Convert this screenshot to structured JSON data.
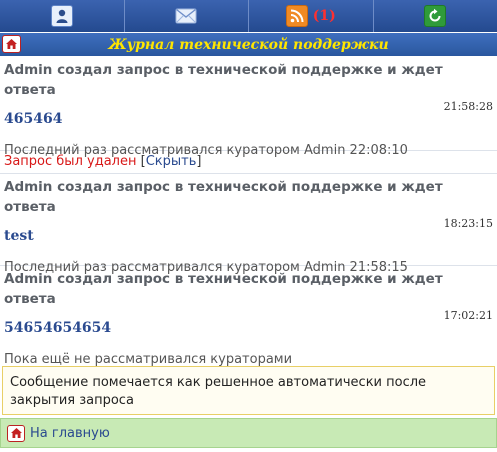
{
  "nav": {
    "items": [
      {
        "icon": "user-icon"
      },
      {
        "icon": "mail-icon"
      },
      {
        "icon": "rss-icon",
        "badge": "(1)"
      },
      {
        "icon": "refresh-icon"
      }
    ]
  },
  "header": {
    "title": "Журнал технической поддержки",
    "home_icon": "home-icon"
  },
  "entries": [
    {
      "head": "Admin создал запрос в технической поддержке и ждет ответа",
      "time": "21:58:28",
      "subject": "465464",
      "status": "Последний раз рассматривался куратором Admin 22:08:10"
    },
    {
      "head": "Admin создал запрос в технической поддержке и ждет ответа",
      "time": "18:23:15",
      "subject": "test",
      "status": "Последний раз рассматривался куратором Admin 21:58:15"
    },
    {
      "head": "Admin создал запрос в технической поддержке и ждет ответа",
      "time": "17:02:21",
      "subject": "54654654654",
      "status": "Пока ещё не рассматривался кураторами"
    }
  ],
  "deleted": {
    "text": "Запрос был удален",
    "open_bracket": "[",
    "link": "Скрыть",
    "close_bracket": "]"
  },
  "notice": {
    "text": "Сообщение помечается как решенное автоматически после закрытия запроса"
  },
  "footer": {
    "home_label": "На главную"
  },
  "colors": {
    "nav_bg": "#2b4d8c",
    "title_text": "#ffe600",
    "deleted_text": "#d81818",
    "link": "#2a4a8f",
    "home_bar_bg": "#c8eab5"
  }
}
